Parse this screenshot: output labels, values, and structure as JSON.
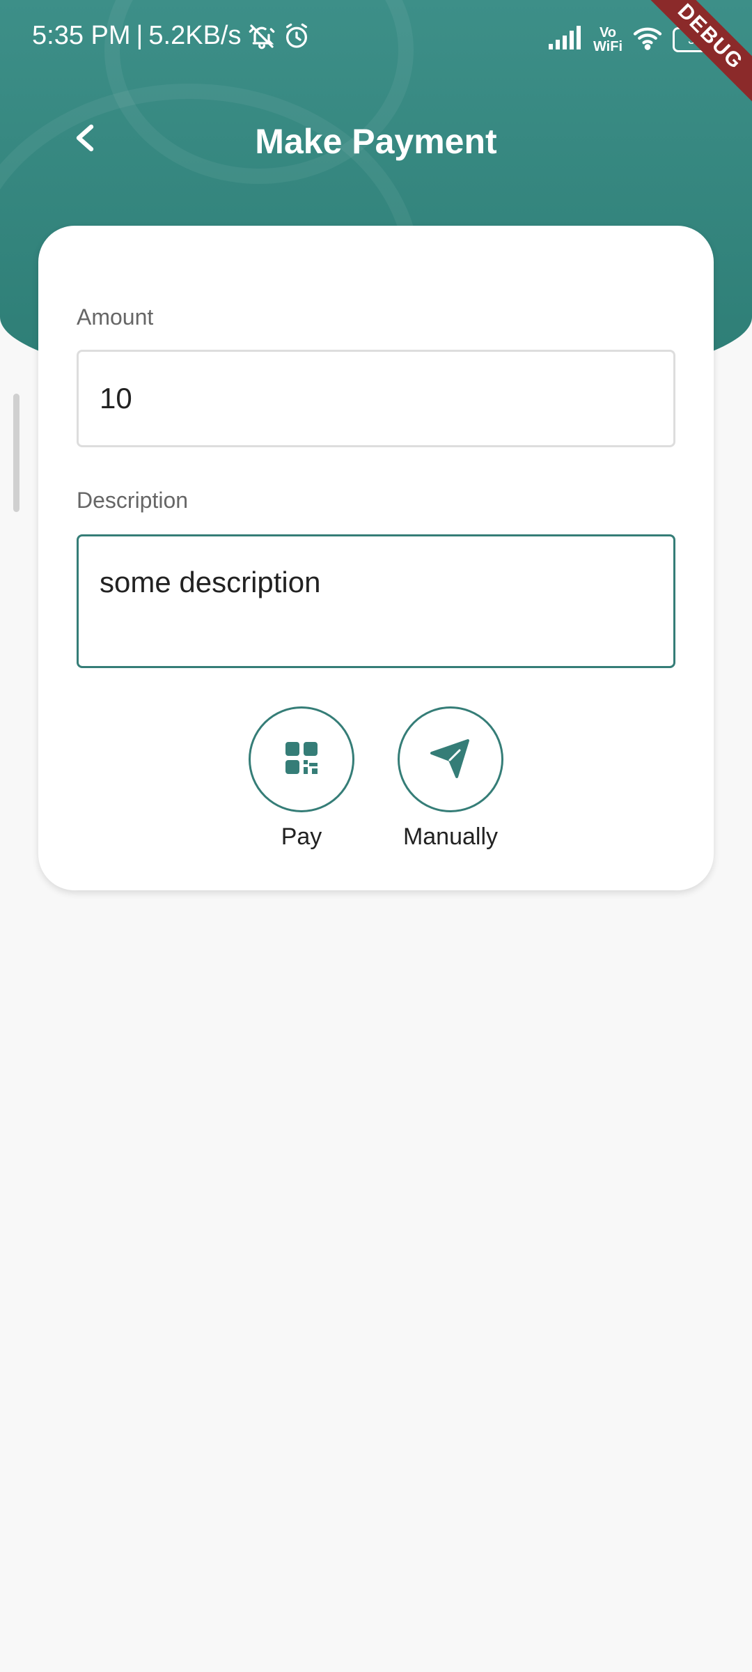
{
  "status_bar": {
    "time": "5:35 PM",
    "separator": "|",
    "network_speed": "5.2KB/s",
    "vowifi_top": "Vo",
    "vowifi_bottom": "WiFi",
    "battery": "33"
  },
  "debug_banner": "DEBUG",
  "app_bar": {
    "title": "Make Payment"
  },
  "form": {
    "amount_label": "Amount",
    "amount_value": "10",
    "description_label": "Description",
    "description_value": "some description"
  },
  "actions": [
    {
      "label": "Pay",
      "icon": "qr-code-icon"
    },
    {
      "label": "Manually",
      "icon": "send-icon"
    }
  ],
  "colors": {
    "header": "#3d8f88",
    "accent": "#357d77",
    "background": "#f8f8f8",
    "debug": "#8b2a2a"
  }
}
